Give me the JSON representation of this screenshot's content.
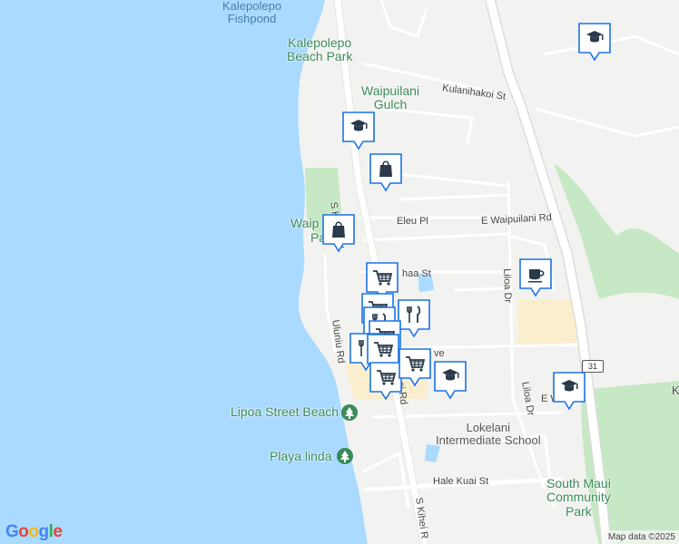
{
  "map": {
    "colors": {
      "ocean": "#aadaff",
      "land": "#f2f2f0",
      "park": "#c6e8c4",
      "road": "#ffffff",
      "major_road": "#fde293",
      "pin_fill": "#ffffff",
      "pin_border": "#1a73e8",
      "pin_icon": "#2a3a4a"
    },
    "labels": {
      "kalepolepo_fishpond": "Kalepolepo\nFishpond",
      "kalepolepo_beach_park": "Kalepolepo\nBeach Park",
      "waipuilani_gulch": "Waipuilani\nGulch",
      "waipuilani_park_partial_1": "Waip",
      "waipuilani_park_partial_2": "Pa",
      "lipoa_street_beach": "Lipoa Street Beach",
      "playa_linda": "Playa linda",
      "lokelani_school": "Lokelani\nIntermediate School",
      "south_maui_park": "South Maui\nCommunity\nPark",
      "kulanihakoi_st": "Kulanihakoi St",
      "eleu_pl": "Eleu Pl",
      "e_waipuilani_rd": "E Waipuilani Rd",
      "s_kihei_rd_top": "S Kihei Rd",
      "s_kihei_rd_mid": "ei Rd",
      "s_kihei_rd_bottom": "S Kihei R",
      "uluniu_rd": "Uluniu Rd",
      "liloa_dr_1": "Liloa Dr",
      "liloa_dr_2": "Liloa Dr",
      "haa_st": "haa St",
      "ave": "ve",
      "hale_kuai_st": "Hale Kuai St",
      "e_w_partial": "E W",
      "k_partial": "K",
      "route_31": "31"
    },
    "pins": [
      {
        "type": "school",
        "icon": "graduation-cap-icon"
      },
      {
        "type": "school",
        "icon": "graduation-cap-icon"
      },
      {
        "type": "shopping",
        "icon": "shopping-bag-icon"
      },
      {
        "type": "shopping",
        "icon": "shopping-bag-icon"
      },
      {
        "type": "grocery",
        "icon": "shopping-cart-icon"
      },
      {
        "type": "cafe",
        "icon": "coffee-cup-icon"
      },
      {
        "type": "grocery",
        "icon": "shopping-cart-icon"
      },
      {
        "type": "restaurant",
        "icon": "fork-knife-icon"
      },
      {
        "type": "restaurant",
        "icon": "fork-knife-icon"
      },
      {
        "type": "grocery",
        "icon": "shopping-cart-icon"
      },
      {
        "type": "restaurant",
        "icon": "fork-knife-icon"
      },
      {
        "type": "grocery",
        "icon": "shopping-cart-icon"
      },
      {
        "type": "grocery",
        "icon": "shopping-cart-icon"
      },
      {
        "type": "grocery",
        "icon": "shopping-cart-icon"
      },
      {
        "type": "school",
        "icon": "graduation-cap-icon"
      },
      {
        "type": "school",
        "icon": "graduation-cap-icon"
      }
    ],
    "google_logo": "Google",
    "attribution": "Map data ©2025"
  }
}
